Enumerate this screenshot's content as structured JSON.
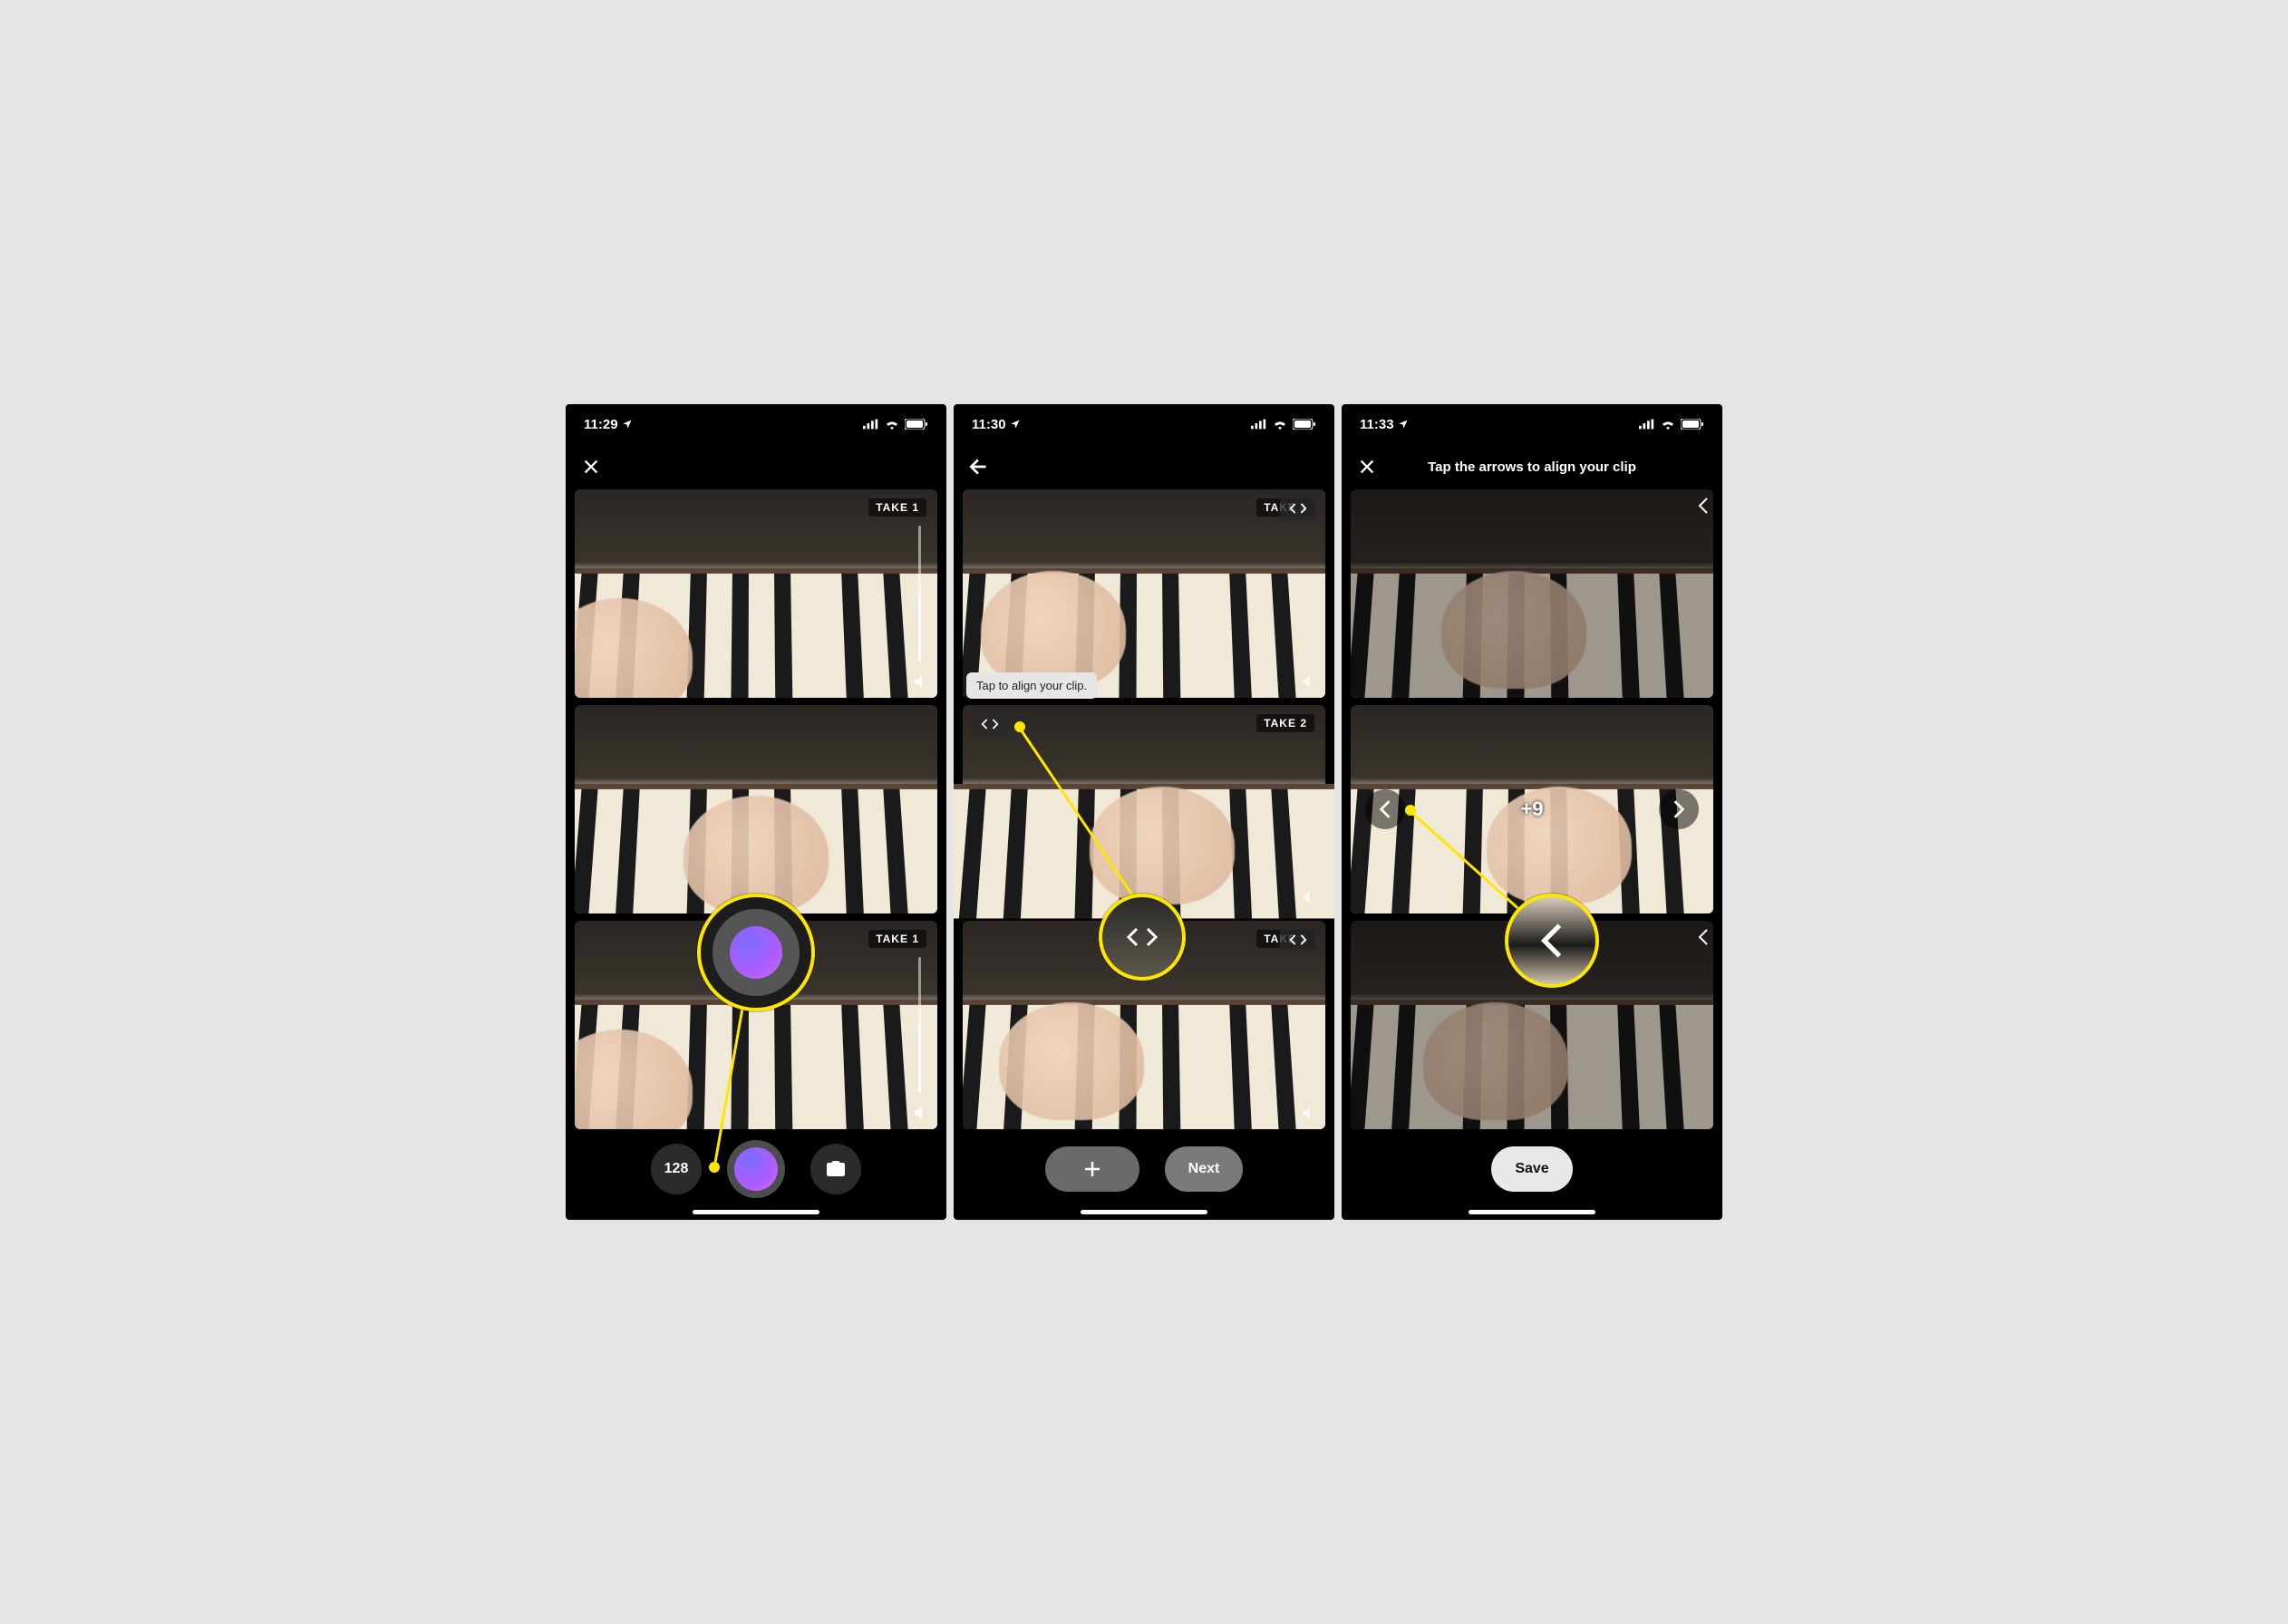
{
  "screens": [
    {
      "status": {
        "time": "11:29",
        "location_icon": "location-arrow-icon"
      },
      "header": {
        "left_icon": "close-icon"
      },
      "clips": [
        {
          "take_label": "TAKE 1",
          "has_volume_slider": true
        },
        {
          "take_label": ""
        },
        {
          "take_label": "TAKE 1",
          "has_volume_slider": true
        }
      ],
      "bottom": {
        "bpm_label": "128",
        "record_button": "record-button",
        "switch_camera": "switch-camera-icon"
      },
      "callout": {
        "target": "record-button"
      }
    },
    {
      "status": {
        "time": "11:30",
        "location_icon": "location-arrow-icon"
      },
      "header": {
        "left_icon": "back-arrow-icon"
      },
      "clips": [
        {
          "take_label": "TAKE 1",
          "align_right": true
        },
        {
          "take_label": "TAKE 2",
          "align_left": true,
          "tooltip": "Tap to align your clip."
        },
        {
          "take_label": "TAKE 1",
          "align_right": true
        }
      ],
      "bottom": {
        "add_button": "plus-icon",
        "next_label": "Next"
      },
      "callout": {
        "target": "align-handle"
      }
    },
    {
      "status": {
        "time": "11:33",
        "location_icon": "location-arrow-icon"
      },
      "header": {
        "left_icon": "close-icon",
        "title": "Tap the arrows to align your clip"
      },
      "clips": [
        {
          "take_label": "",
          "align_right_partial": true
        },
        {
          "take_label": "",
          "nudge": true,
          "offset_label": "+9"
        },
        {
          "take_label": "",
          "align_right_partial": true
        }
      ],
      "bottom": {
        "save_label": "Save"
      },
      "callout": {
        "target": "nudge-left-arrow"
      }
    }
  ]
}
